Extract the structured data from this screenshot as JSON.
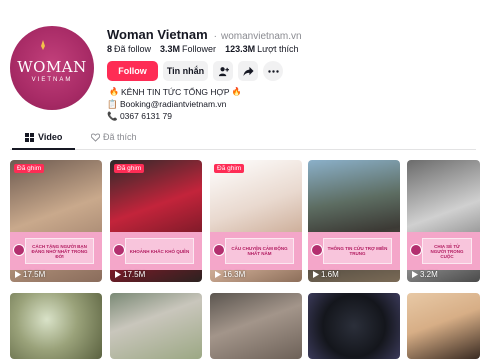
{
  "profile": {
    "display_name": "Woman Vietnam",
    "handle": "womanvietnam.vn",
    "avatar_text": "WOMAN",
    "avatar_subtext": "VIETNAM",
    "stats": [
      {
        "value": "8",
        "label": "Đã follow"
      },
      {
        "value": "3.3M",
        "label": "Follower"
      },
      {
        "value": "123.3M",
        "label": "Lượt thích"
      }
    ],
    "follow_label": "Follow",
    "message_label": "Tin nhắn",
    "bio": {
      "line1": "KÊNH TIN TỨC TỔNG HỢP",
      "line2": "📋 Booking@radiantvietnam.vn",
      "line3": "📞 0367 6131 79"
    }
  },
  "tabs": [
    {
      "label": "Video",
      "active": true
    },
    {
      "label": "Đã thích",
      "active": false
    }
  ],
  "videos": [
    {
      "pinned": "Đã ghim",
      "views": "17.5M",
      "caption": "CÁCH TẶNG NGƯỜI BẠN ĐÁNG NHỚ NHẤT TRONG ĐỜI"
    },
    {
      "pinned": "Đã ghim",
      "views": "17.5M",
      "caption": "KHOẢNH KHẮC KHÓ QUÊN"
    },
    {
      "pinned": "Đã ghim",
      "views": "16.3M",
      "caption": "CÂU CHUYỆN CẢM ĐỘNG NHẤT NĂM"
    },
    {
      "pinned": "",
      "views": "1.6M",
      "caption": "THÔNG TIN CỨU TRỢ MIỀN TRUNG"
    },
    {
      "pinned": "",
      "views": "3.2M",
      "caption": "CHIA SẺ TỪ NGƯỜI TRONG CUỘC"
    }
  ],
  "colors": {
    "accent": "#fe2c55",
    "brand": "#a82b66",
    "banner": "#f4a6c9"
  }
}
